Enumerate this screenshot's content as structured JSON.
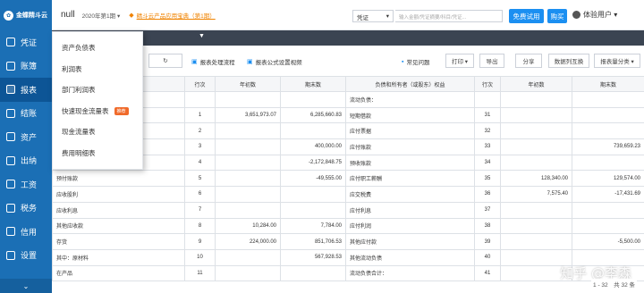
{
  "sidebar": {
    "logo": "金蝶精斗云",
    "items": [
      {
        "label": "凭证",
        "icon": "voucher-icon"
      },
      {
        "label": "账簿",
        "icon": "ledger-icon"
      },
      {
        "label": "报表",
        "icon": "report-icon"
      },
      {
        "label": "结账",
        "icon": "closing-icon"
      },
      {
        "label": "资产",
        "icon": "asset-icon"
      },
      {
        "label": "出纳",
        "icon": "cashier-icon"
      },
      {
        "label": "工资",
        "icon": "salary-icon"
      },
      {
        "label": "税务",
        "icon": "tax-icon"
      },
      {
        "label": "信用",
        "icon": "credit-icon"
      },
      {
        "label": "设置",
        "icon": "settings-icon"
      }
    ],
    "active_index": 2,
    "collapse": "⌄"
  },
  "topbar": {
    "company": "null",
    "period": "2020年第1期 ▾",
    "notice": "精斗云产品应用宝典（第1期）",
    "voucher_select": "凭证",
    "search_placeholder": "输入金额/凭证摘要/科目/凭证...",
    "trial_button": "免费试用",
    "buy_button": "购买",
    "user": "体验用户 ▾"
  },
  "toolbar": {
    "refresh": "↻",
    "link1": "报表处理流程",
    "link2": "报表公式设置视频",
    "faq": "常见问题",
    "print": "打印 ▾",
    "export": "导出",
    "share": "分享",
    "swap": "数据列互换",
    "quantity": "报表量分类 ▾"
  },
  "menu": {
    "items": [
      {
        "label": "资产负债表",
        "badge": ""
      },
      {
        "label": "利润表",
        "badge": ""
      },
      {
        "label": "部门利润表",
        "badge": ""
      },
      {
        "label": "快速现金流量表",
        "badge": "推荐"
      },
      {
        "label": "现金流量表",
        "badge": ""
      },
      {
        "label": "费用明细表",
        "badge": ""
      }
    ]
  },
  "table": {
    "headers": [
      "行次",
      "年初数",
      "期末数",
      "负债和所有者（或股东）权益",
      "行次",
      "年初数",
      "期末数"
    ],
    "rows": [
      [
        "",
        "",
        "",
        "",
        "流动负债：",
        "",
        "",
        ""
      ],
      [
        "",
        "1",
        "3,651,973.07",
        "6,285,660.83",
        "短期借款",
        "31",
        "",
        ""
      ],
      [
        "",
        "2",
        "",
        "",
        "应付票据",
        "32",
        "",
        ""
      ],
      [
        "",
        "3",
        "",
        "400,000.00",
        "应付账款",
        "33",
        "",
        "739,659.23"
      ],
      [
        "",
        "4",
        "",
        "-2,172,848.75",
        "预收账款",
        "34",
        "",
        ""
      ],
      [
        "预付账款",
        "5",
        "",
        "-49,555.00",
        "应付职工薪酬",
        "35",
        "128,340.00",
        "129,574.00"
      ],
      [
        "应收股利",
        "6",
        "",
        "",
        "应交税费",
        "36",
        "7,575.40",
        "-17,431.69"
      ],
      [
        "应收利息",
        "7",
        "",
        "",
        "应付利息",
        "37",
        "",
        ""
      ],
      [
        "其他应收款",
        "8",
        "10,284.00",
        "7,784.00",
        "应付利润",
        "38",
        "",
        ""
      ],
      [
        "存货",
        "9",
        "224,000.00",
        "851,706.53",
        "其他应付款",
        "39",
        "",
        "-5,500.00"
      ],
      [
        "其中：原材料",
        "10",
        "",
        "567,928.53",
        "其他流动负债",
        "40",
        "",
        ""
      ],
      [
        "    在产品",
        "11",
        "",
        "",
        "流动负债合计：",
        "41",
        "",
        ""
      ]
    ]
  },
  "pager": "1 - 32　共 32 条",
  "watermark": "知乎 @李森"
}
